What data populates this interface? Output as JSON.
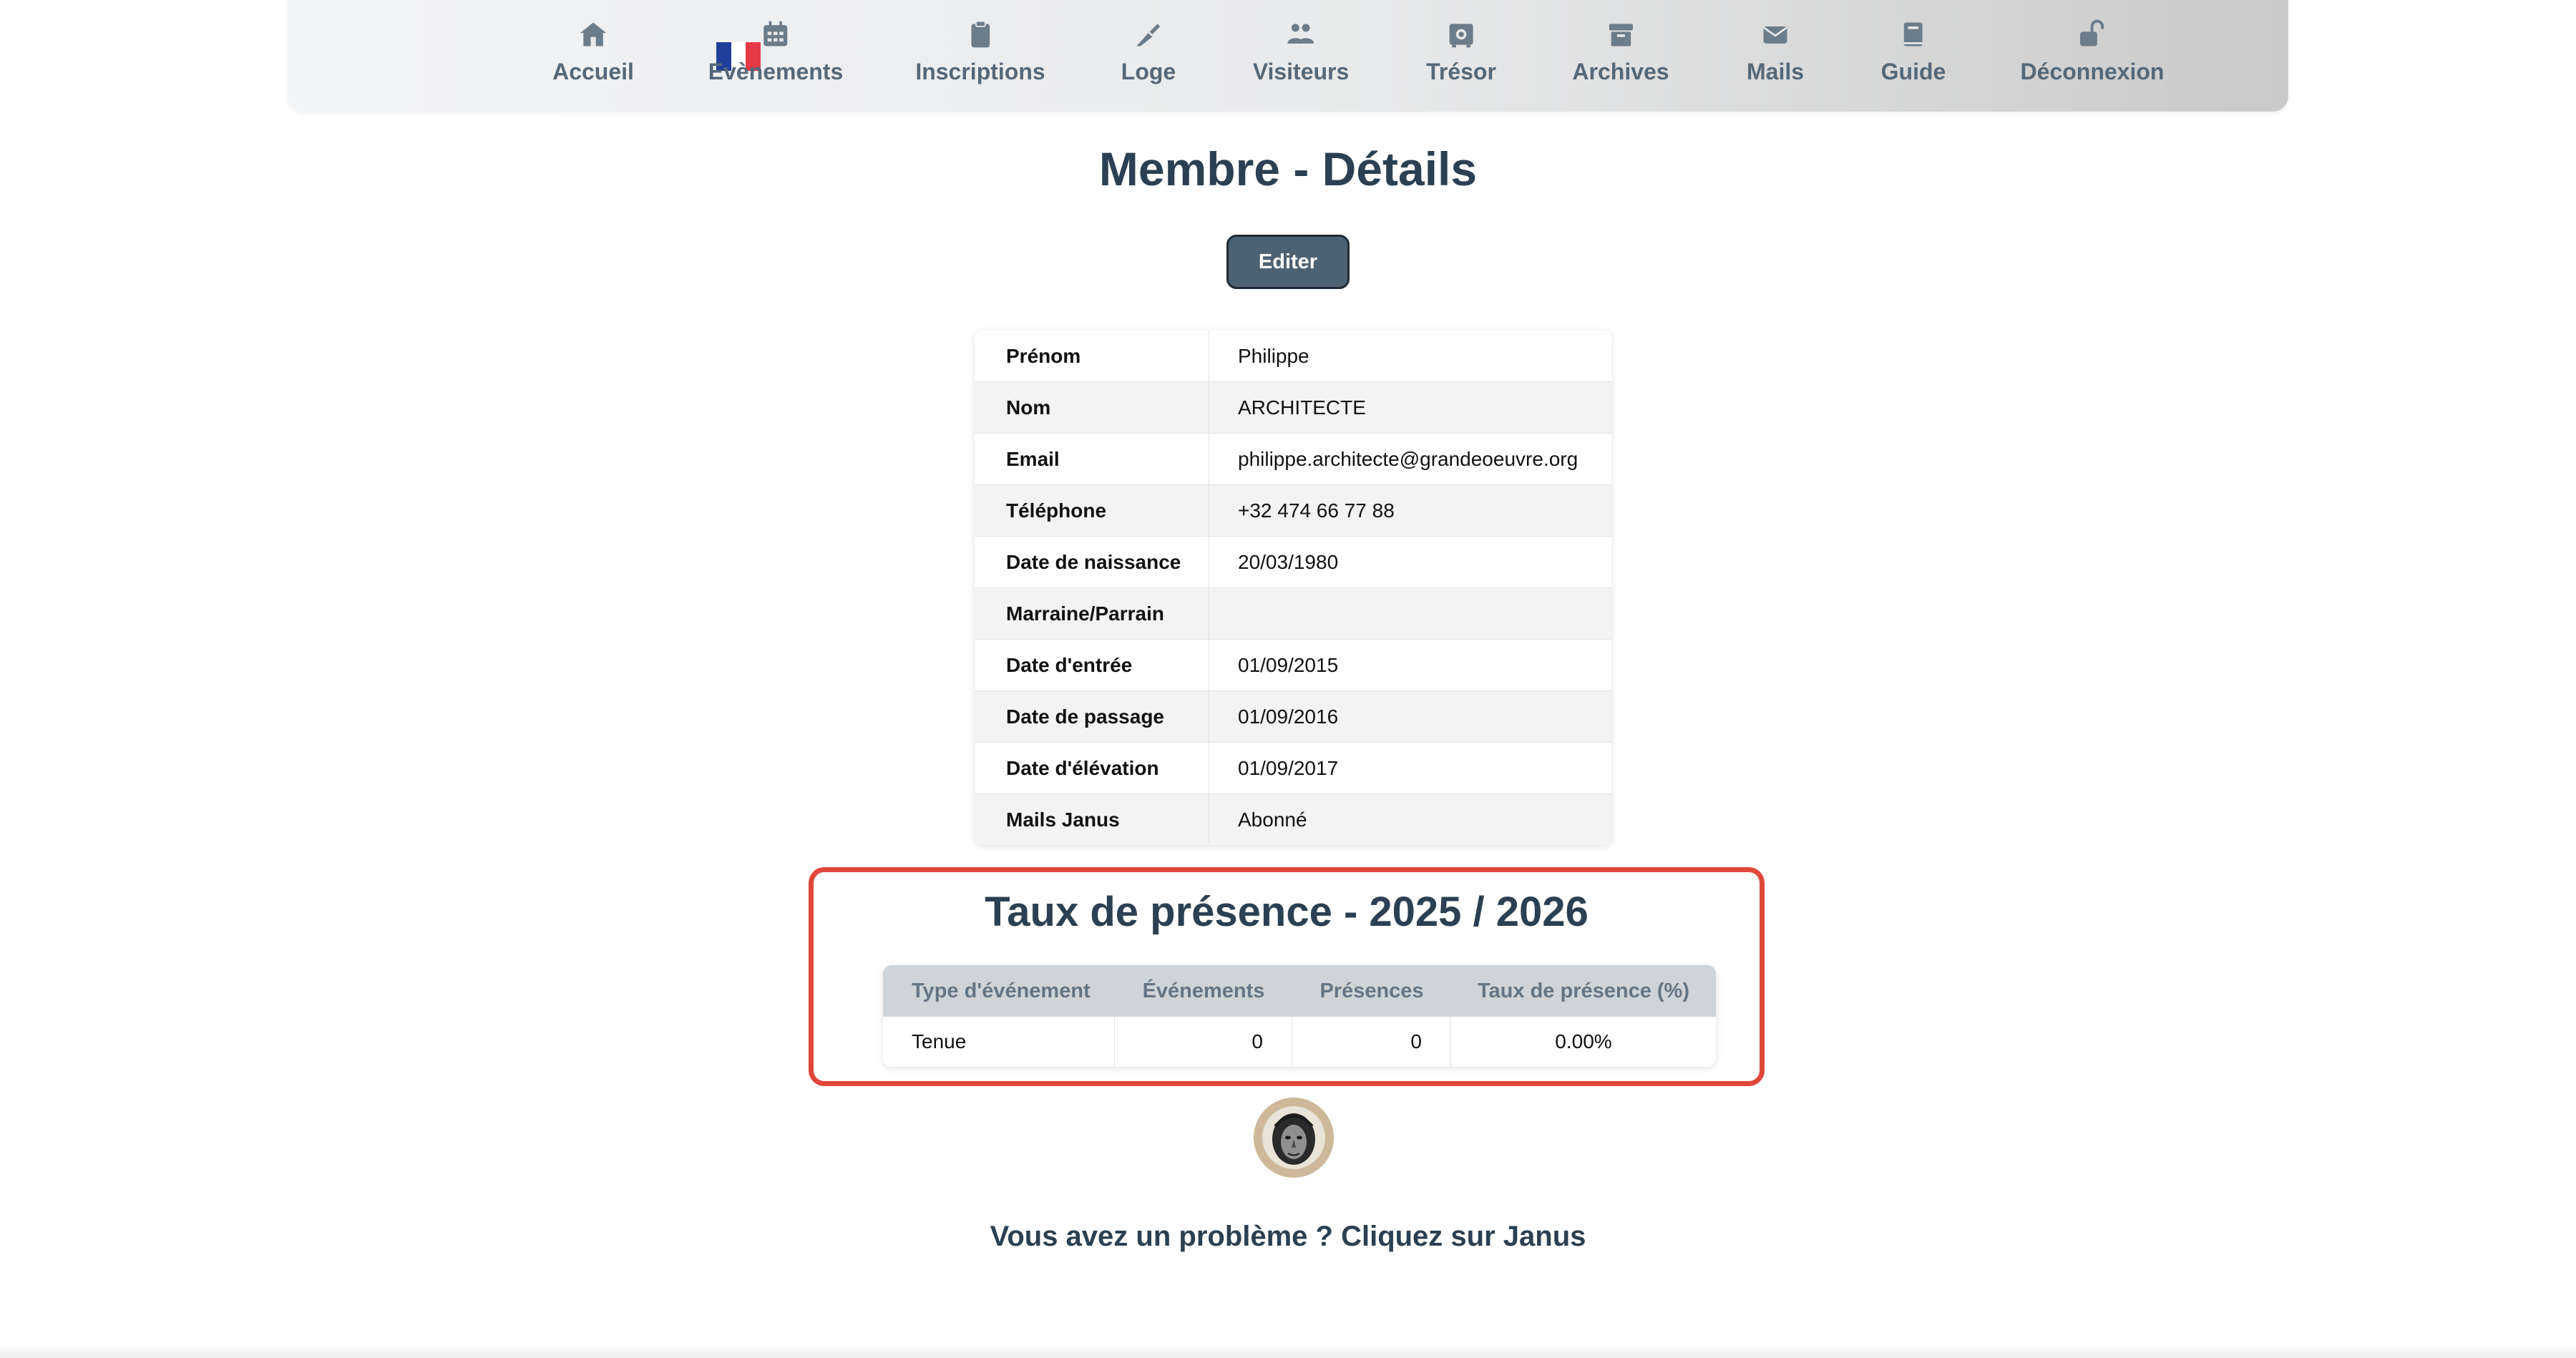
{
  "nav": {
    "flag_colors": [
      "#1f3f9b",
      "#ffffff",
      "#e63946"
    ],
    "items": [
      {
        "label": "Accueil",
        "icon": "home-icon"
      },
      {
        "label": "Evènements",
        "icon": "calendar-icon"
      },
      {
        "label": "Inscriptions",
        "icon": "clipboard-icon"
      },
      {
        "label": "Loge",
        "icon": "trowel-icon"
      },
      {
        "label": "Visiteurs",
        "icon": "users-icon"
      },
      {
        "label": "Trésor",
        "icon": "safe-icon"
      },
      {
        "label": "Archives",
        "icon": "archive-box-icon"
      },
      {
        "label": "Mails",
        "icon": "envelope-icon"
      },
      {
        "label": "Guide",
        "icon": "book-icon"
      },
      {
        "label": "Déconnexion",
        "icon": "unlock-icon"
      }
    ]
  },
  "page": {
    "title": "Membre - Détails",
    "edit_label": "Editer"
  },
  "details": [
    {
      "label": "Prénom",
      "value": "Philippe"
    },
    {
      "label": "Nom",
      "value": "ARCHITECTE"
    },
    {
      "label": "Email",
      "value": "philippe.architecte@grandeoeuvre.org"
    },
    {
      "label": "Téléphone",
      "value": "+32 474 66 77 88"
    },
    {
      "label": "Date de naissance",
      "value": "20/03/1980"
    },
    {
      "label": "Marraine/Parrain",
      "value": ""
    },
    {
      "label": "Date d'entrée",
      "value": "01/09/2015"
    },
    {
      "label": "Date de passage",
      "value": "01/09/2016"
    },
    {
      "label": "Date d'élévation",
      "value": "01/09/2017"
    },
    {
      "label": "Mails Janus",
      "value": "Abonné"
    }
  ],
  "attendance": {
    "title": "Taux de présence - 2025 / 2026",
    "headers": [
      "Type d'événement",
      "Événements",
      "Présences",
      "Taux de présence (%)"
    ],
    "rows": [
      {
        "type": "Tenue",
        "events": "0",
        "presences": "0",
        "rate": "0.00%"
      }
    ]
  },
  "footer": {
    "help_text": "Vous avez un problème ? Cliquez sur Janus",
    "logo_icon": "janus-head-icon"
  },
  "colors": {
    "accent_dark": "#2b4052",
    "button": "#4c6172",
    "highlight_border": "#e0473a",
    "nav_text": "#546879"
  }
}
